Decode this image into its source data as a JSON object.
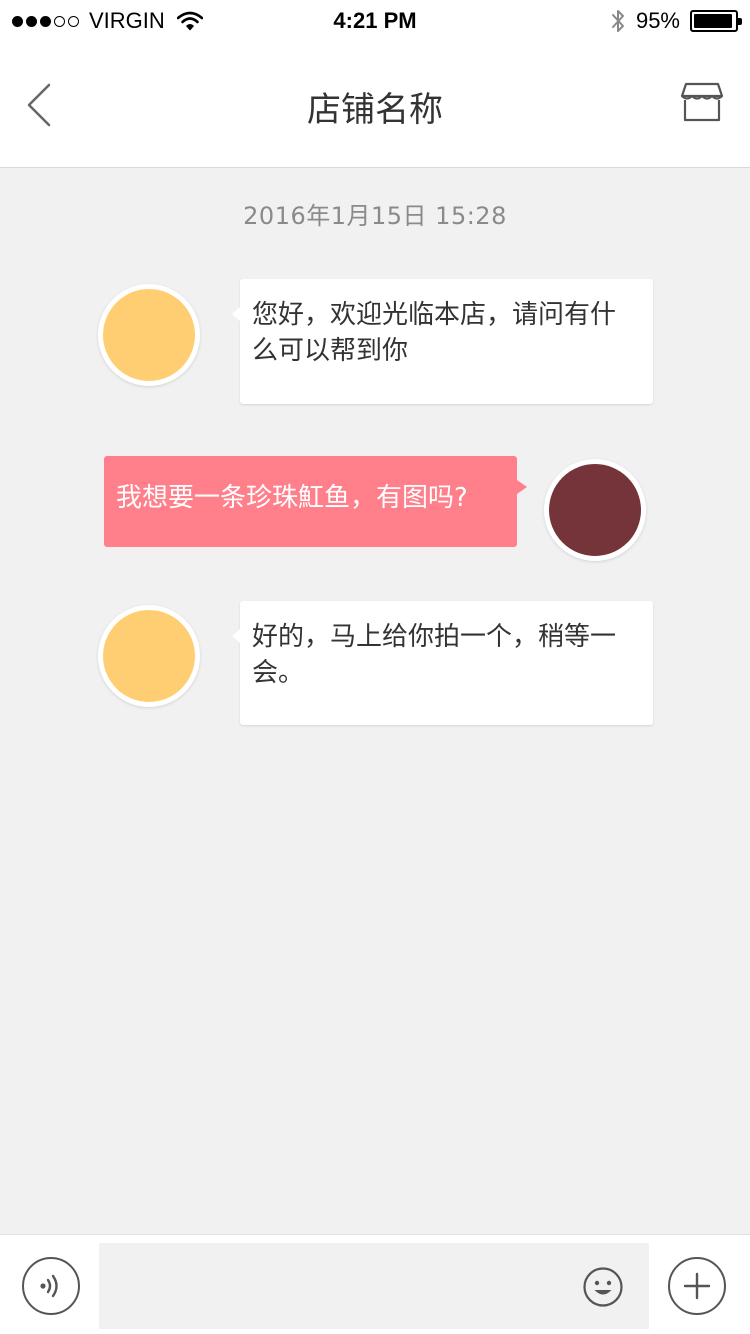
{
  "status_bar": {
    "carrier": "VIRGIN",
    "time": "4:21 PM",
    "battery": "95%",
    "battery_level": 0.95,
    "signal_dots_filled": 3,
    "signal_dots_total": 5
  },
  "nav": {
    "title": "店铺名称",
    "back_icon": "chevron-left-icon",
    "store_icon": "storefront-icon"
  },
  "chat": {
    "timestamp": "2016年1月15日   15:28",
    "messages": [
      {
        "side": "received",
        "text": "您好，欢迎光临本店，请问有什么可以帮到你"
      },
      {
        "side": "sent",
        "text": "我想要一条珍珠魟鱼，有图吗?"
      },
      {
        "side": "received",
        "text": "好的，马上给你拍一个，稍等一会。"
      }
    ]
  },
  "input_bar": {
    "value": "",
    "placeholder": "",
    "voice_icon": "voice-icon",
    "emoji_icon": "emoji-icon",
    "plus_icon": "plus-icon"
  },
  "colors": {
    "shop_avatar": "#ffce73",
    "user_avatar": "#75333a",
    "sent_bubble": "#ff7f8a",
    "received_bubble": "#ffffff",
    "background": "#f1f1f1"
  }
}
